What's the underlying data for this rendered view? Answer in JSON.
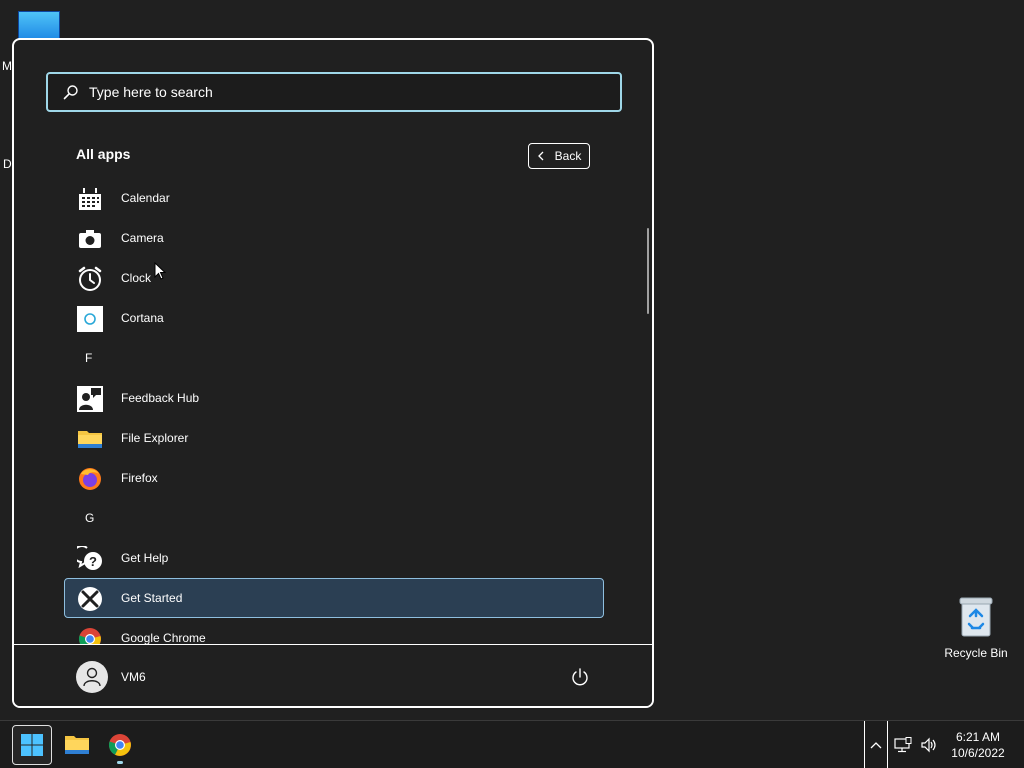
{
  "desktop": {
    "fragment_m": "M",
    "fragment_d": "D",
    "recycle_bin_label": "Recycle Bin"
  },
  "start_menu": {
    "search": {
      "placeholder": "Type here to search",
      "value": ""
    },
    "all_apps_title": "All apps",
    "back_label": "Back",
    "apps": [
      {
        "type": "app",
        "label": "Calendar",
        "icon": "calendar-icon"
      },
      {
        "type": "app",
        "label": "Camera",
        "icon": "camera-icon"
      },
      {
        "type": "app",
        "label": "Clock",
        "icon": "clock-icon"
      },
      {
        "type": "app",
        "label": "Cortana",
        "icon": "cortana-icon"
      },
      {
        "type": "letter",
        "label": "F"
      },
      {
        "type": "app",
        "label": "Feedback Hub",
        "icon": "feedback-hub-icon"
      },
      {
        "type": "app",
        "label": "File Explorer",
        "icon": "folder-icon"
      },
      {
        "type": "app",
        "label": "Firefox",
        "icon": "firefox-icon"
      },
      {
        "type": "letter",
        "label": "G"
      },
      {
        "type": "app",
        "label": "Get Help",
        "icon": "get-help-icon"
      },
      {
        "type": "app",
        "label": "Get Started",
        "icon": "get-started-icon",
        "selected": true
      },
      {
        "type": "app",
        "label": "Google Chrome",
        "icon": "chrome-icon"
      }
    ],
    "user_name": "VM6"
  },
  "taskbar": {
    "time": "6:21 AM",
    "date": "10/6/2022",
    "pinned": [
      "start-icon",
      "folder-icon",
      "chrome-icon"
    ]
  },
  "colors": {
    "background": "#202020",
    "accent": "#9fd7e8",
    "selected_row": "#2b3f53"
  }
}
